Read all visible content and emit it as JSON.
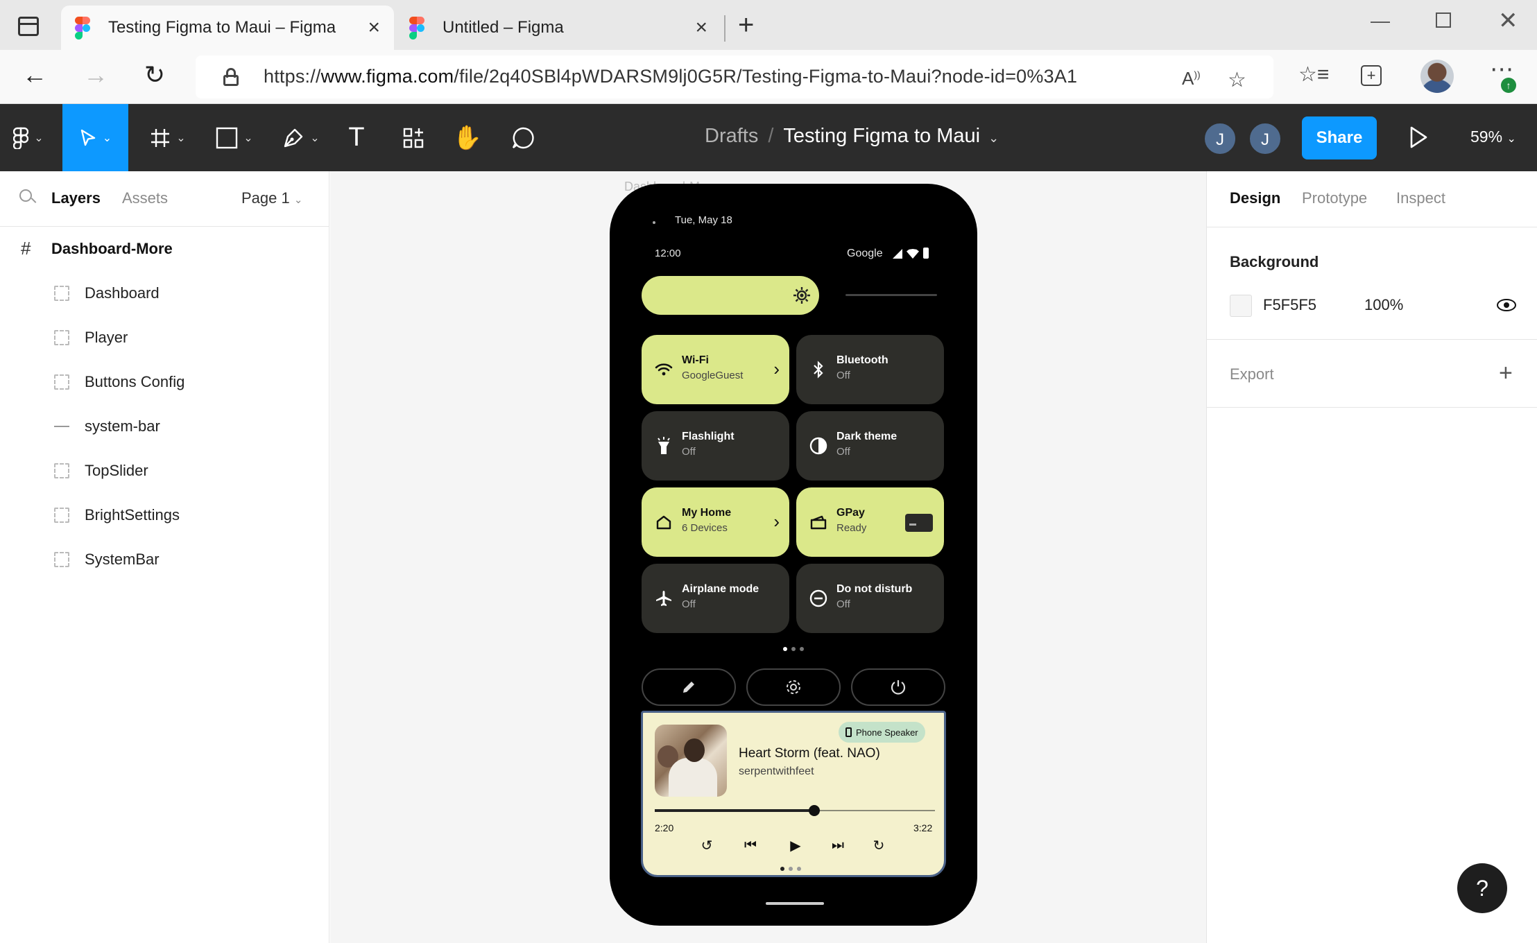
{
  "browser": {
    "tabs": [
      {
        "title": "Testing Figma to Maui – Figma",
        "active": true
      },
      {
        "title": "Untitled – Figma",
        "active": false
      }
    ],
    "url_prefix": "https://",
    "url_host": "www.figma.com",
    "url_path": "/file/2q40SBl4pWDARSM9lj0G5R/Testing-Figma-to-Maui?node-id=0%3A1"
  },
  "toolbar": {
    "breadcrumb_root": "Drafts",
    "breadcrumb_sep": "/",
    "file_name": "Testing Figma to Maui",
    "users": [
      "J",
      "J"
    ],
    "share_label": "Share",
    "zoom": "59%"
  },
  "layers_panel": {
    "tabs": [
      "Layers",
      "Assets"
    ],
    "page": "Page 1",
    "root": "Dashboard-More",
    "items": [
      "Dashboard",
      "Player",
      "Buttons Config",
      "system-bar",
      "TopSlider",
      "BrightSettings",
      "SystemBar"
    ]
  },
  "canvas": {
    "frame_label": "Dashboard-More",
    "phone": {
      "date": "Tue, May 18",
      "time": "12:00",
      "carrier": "Google",
      "brightness": 0.6,
      "tiles": [
        {
          "title": "Wi-Fi",
          "sub": "GoogleGuest",
          "state": "on"
        },
        {
          "title": "Bluetooth",
          "sub": "Off",
          "state": "off"
        },
        {
          "title": "Flashlight",
          "sub": "Off",
          "state": "off"
        },
        {
          "title": "Dark theme",
          "sub": "Off",
          "state": "off"
        },
        {
          "title": "My Home",
          "sub": "6 Devices",
          "state": "on"
        },
        {
          "title": "GPay",
          "sub": "Ready",
          "state": "on"
        },
        {
          "title": "Airplane mode",
          "sub": "Off",
          "state": "off"
        },
        {
          "title": "Do not disturb",
          "sub": "Off",
          "state": "off"
        }
      ],
      "player": {
        "output": "Phone Speaker",
        "title": "Heart Storm (feat. NAO)",
        "artist": "serpentwithfeet",
        "elapsed": "2:20",
        "duration": "3:22",
        "progress": 0.57
      }
    }
  },
  "design_panel": {
    "tabs": [
      "Design",
      "Prototype",
      "Inspect"
    ],
    "background_title": "Background",
    "bg_hex": "F5F5F5",
    "bg_opacity": "100%",
    "export_label": "Export",
    "help": "?"
  },
  "colors": {
    "accent": "#0d99ff",
    "tile_on": "#dbe88a",
    "tile_off": "#2e2e2a",
    "player_bg": "#f4f1cd"
  }
}
